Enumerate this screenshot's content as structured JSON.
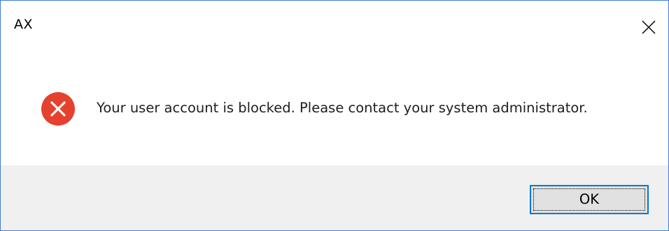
{
  "window": {
    "title": "AX"
  },
  "dialog": {
    "message": "Your user account is blocked. Please contact your system administrator.",
    "icon": "error-circle-x-icon",
    "icon_color": "#e5412e"
  },
  "buttons": {
    "ok_label": "OK"
  },
  "icons": {
    "close": "close-icon"
  },
  "colors": {
    "window_border": "#3c7fd4",
    "footer_background": "#f0f0f0",
    "button_border": "#0078d7",
    "button_background": "#e1e1e1"
  }
}
